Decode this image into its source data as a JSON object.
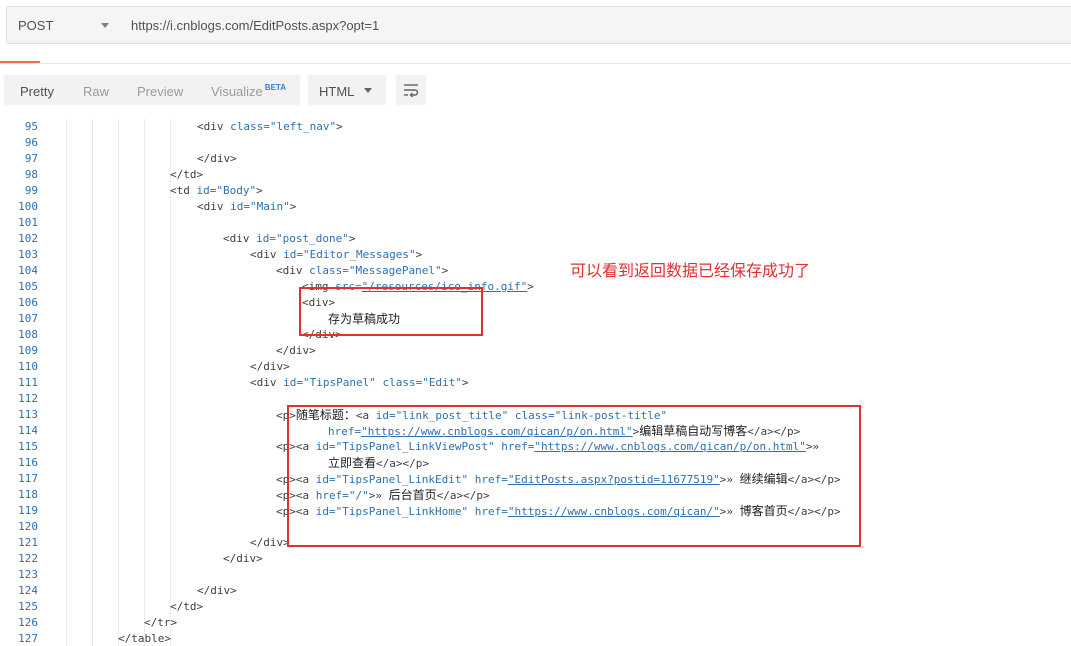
{
  "request": {
    "method": "POST",
    "url": "https://i.cnblogs.com/EditPosts.aspx?opt=1"
  },
  "toolbar": {
    "tabs": [
      "Pretty",
      "Raw",
      "Preview",
      "Visualize"
    ],
    "visualize_badge": "BETA",
    "format": "HTML",
    "wrap_icon": "wrap-lines-icon"
  },
  "annotation": {
    "text": "可以看到返回数据已经保存成功了"
  },
  "lines": [
    {
      "n": "95"
    },
    {
      "n": "96"
    },
    {
      "n": "97"
    },
    {
      "n": "98"
    },
    {
      "n": "99"
    },
    {
      "n": "100"
    },
    {
      "n": "101"
    },
    {
      "n": "102"
    },
    {
      "n": "103"
    },
    {
      "n": "104"
    },
    {
      "n": "105"
    },
    {
      "n": "106"
    },
    {
      "n": "107"
    },
    {
      "n": "108"
    },
    {
      "n": "109"
    },
    {
      "n": "110"
    },
    {
      "n": "111"
    },
    {
      "n": "112"
    },
    {
      "n": "113"
    },
    {
      "n": "114"
    },
    {
      "n": "115"
    },
    {
      "n": "116"
    },
    {
      "n": "117"
    },
    {
      "n": "118"
    },
    {
      "n": "119"
    },
    {
      "n": "120"
    },
    {
      "n": "121"
    },
    {
      "n": "122"
    },
    {
      "n": "123"
    },
    {
      "n": "124"
    },
    {
      "n": "125"
    },
    {
      "n": "126"
    },
    {
      "n": "127"
    }
  ],
  "code": {
    "l95": {
      "open": "<div ",
      "attr": "class=",
      "val": "\"left_nav\"",
      "close": ">"
    },
    "l97": "</div>",
    "l98": "</td>",
    "l99": {
      "open": "<td ",
      "attr": "id=",
      "val": "\"Body\"",
      "close": ">"
    },
    "l100": {
      "open": "<div ",
      "attr": "id=",
      "val": "\"Main\"",
      "close": ">"
    },
    "l102": {
      "open": "<div ",
      "attr": "id=",
      "val": "\"post_done\"",
      "close": ">"
    },
    "l103": {
      "open": "<div ",
      "attr": "id=",
      "val": "\"Editor_Messages\"",
      "close": ">"
    },
    "l104": {
      "open": "<div ",
      "attr": "class=",
      "val": "\"MessagePanel\"",
      "close": ">"
    },
    "l105": {
      "open": "<img ",
      "attr": "src=",
      "val": "\"/resources/ico_info.gif\"",
      "close": ">"
    },
    "l106": "<div>",
    "l107": "存为草稿成功",
    "l108": "</div>",
    "l109": "</div>",
    "l110": "</div>",
    "l111": {
      "open": "<div ",
      "attr": "id=",
      "val": "\"TipsPanel\"",
      "attr2": " class=",
      "val2": "\"Edit\"",
      "close": ">"
    },
    "l113": {
      "p": "<p>",
      "label": "随笔标题：",
      "open": "<a ",
      "attr": "id=",
      "val": "\"link_post_title\"",
      "attr2": " class=",
      "val2": "\"link-post-title\""
    },
    "l114": {
      "attr": "href=",
      "val": "\"https://www.cnblogs.com/qican/p/on.html\"",
      "close": ">",
      "text": "编辑草稿自动写博客",
      "end": "</a></p>"
    },
    "l115": {
      "p": "<p>",
      "open": "<a ",
      "attr": "id=",
      "val": "\"TipsPanel_LinkViewPost\"",
      "attr2": " href=",
      "val2": "\"https://www.cnblogs.com/qican/p/on.html\"",
      "close": ">»"
    },
    "l116": {
      "text": "立即查看",
      "end": "</a></p>"
    },
    "l117": {
      "p": "<p>",
      "open": "<a ",
      "attr": "id=",
      "val": "\"TipsPanel_LinkEdit\"",
      "attr2": " href=",
      "val2": "\"EditPosts.aspx?postid=11677519\"",
      "close": ">» ",
      "text": "继续编辑",
      "end": "</a></p>"
    },
    "l118": {
      "p": "<p>",
      "open": "<a ",
      "attr": "href=",
      "val": "\"/\"",
      "close": ">» ",
      "text": "后台首页",
      "end": "</a></p>"
    },
    "l119": {
      "p": "<p>",
      "open": "<a ",
      "attr": "id=",
      "val": "\"TipsPanel_LinkHome\"",
      "attr2": " href=",
      "val2": "\"https://www.cnblogs.com/qican/\"",
      "close": ">» ",
      "text": "博客首页",
      "end": "</a></p>"
    },
    "l121": "</div>",
    "l122": "</div>",
    "l124": "</div>",
    "l125": "</td>",
    "l126": "</tr>",
    "l127": "</table>"
  }
}
